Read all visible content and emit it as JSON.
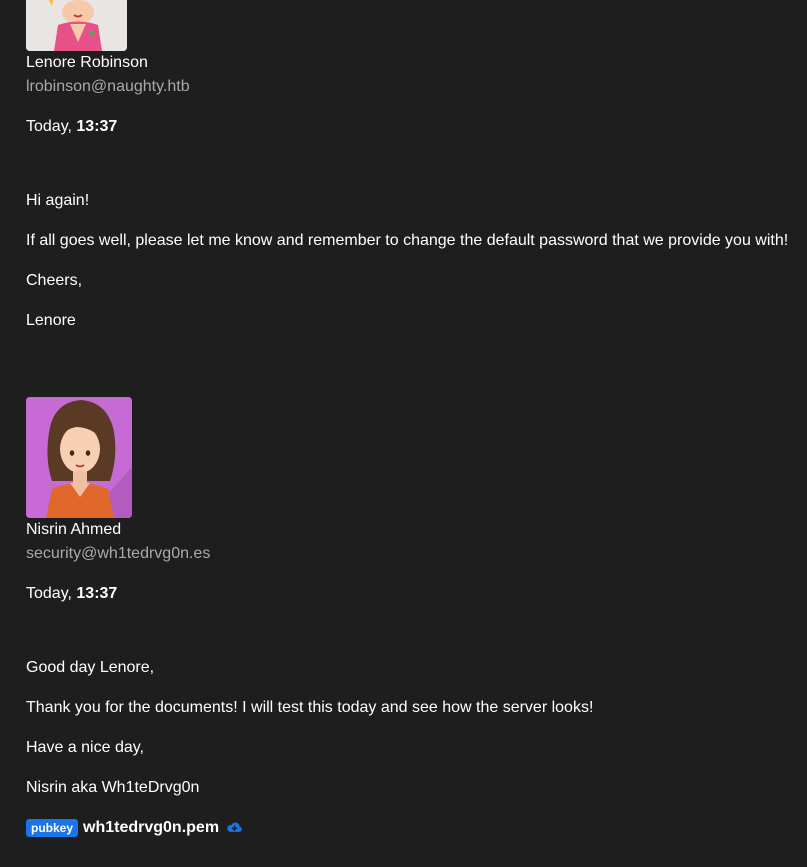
{
  "messages": [
    {
      "sender_name": "Lenore Robinson",
      "sender_email": "lrobinson@naughty.htb",
      "time_prefix": "Today, ",
      "time_value": "13:37",
      "body": [
        "Hi again!",
        "If all goes well, please let me know and remember to change the default password that we provide you with!",
        "Cheers,",
        "Lenore"
      ]
    },
    {
      "sender_name": "Nisrin Ahmed",
      "sender_email": "security@wh1tedrvg0n.es",
      "time_prefix": "Today, ",
      "time_value": "13:37",
      "body": [
        "Good day Lenore,",
        "Thank you for the documents! I will test this today and see how the server looks!",
        "Have a nice day,",
        "Nisrin aka Wh1teDrvg0n"
      ],
      "attachment": {
        "badge": "pubkey",
        "file_name": "wh1tedrvg0n.pem",
        "icon": "cloud-download-icon"
      }
    }
  ],
  "colors": {
    "background": "#1e1e1e",
    "text": "#ffffff",
    "email": "#a9a9a9",
    "badge": "#1a73e8"
  }
}
